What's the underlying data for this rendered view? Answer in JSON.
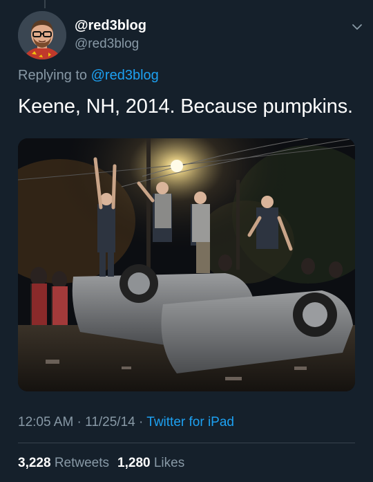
{
  "user": {
    "display_name": "@red3blog",
    "handle": "@red3blog",
    "avatar_icon": "user-avatar-photo"
  },
  "reply": {
    "prefix": "Replying to ",
    "mention": "@red3blog"
  },
  "tweet": {
    "text": "Keene, NH, 2014. Because pumpkins."
  },
  "media": {
    "description_icon": "photo-overturned-car-crowd"
  },
  "meta": {
    "time": "12:05 AM",
    "sep1": " · ",
    "date": "11/25/14",
    "sep2": " · ",
    "source": "Twitter for iPad"
  },
  "stats": {
    "retweets_count": "3,228",
    "retweets_label": "Retweets",
    "likes_count": "1,280",
    "likes_label": "Likes"
  },
  "colors": {
    "background": "#15202b",
    "secondary_text": "#8899a6",
    "link": "#1da1f2",
    "divider": "#38444d"
  }
}
